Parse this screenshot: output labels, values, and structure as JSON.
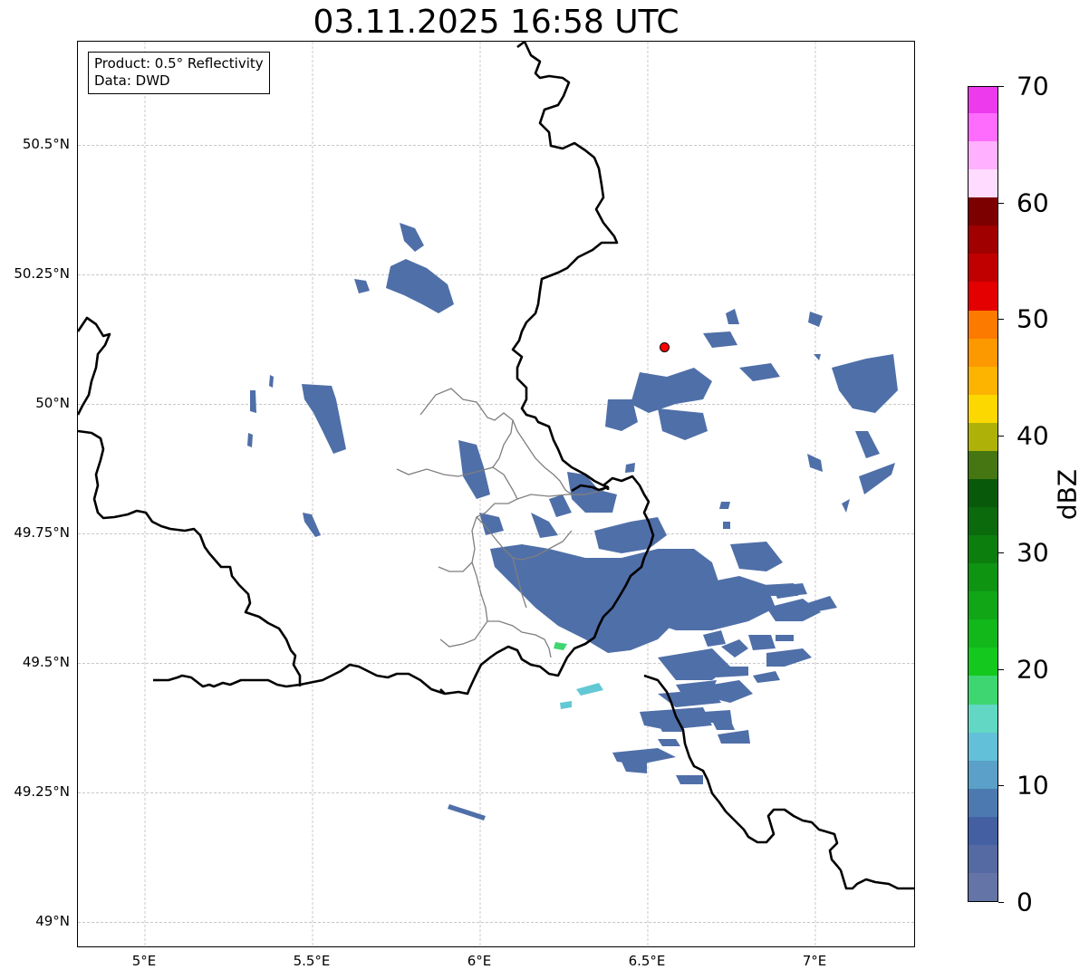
{
  "title": "03.11.2025 16:58 UTC",
  "legend": {
    "product_line": "Product: 0.5° Reflectivity",
    "data_line": "Data: DWD"
  },
  "axes": {
    "lat_labels": [
      {
        "value": 50.5,
        "text": "50.5°N"
      },
      {
        "value": 50.25,
        "text": "50.25°N"
      },
      {
        "value": 50.0,
        "text": "50°N"
      },
      {
        "value": 49.75,
        "text": "49.75°N"
      },
      {
        "value": 49.5,
        "text": "49.5°N"
      },
      {
        "value": 49.25,
        "text": "49.25°N"
      },
      {
        "value": 49.0,
        "text": "49°N"
      }
    ],
    "lon_labels": [
      {
        "value": 5.0,
        "text": "5°E"
      },
      {
        "value": 5.5,
        "text": "5.5°E"
      },
      {
        "value": 6.0,
        "text": "6°E"
      },
      {
        "value": 6.5,
        "text": "6.5°E"
      },
      {
        "value": 7.0,
        "text": "7°E"
      }
    ],
    "lon_range": [
      4.8,
      7.3
    ],
    "lat_range": [
      48.95,
      50.7
    ],
    "grid": true
  },
  "colorbar": {
    "unit": "dBZ",
    "range": [
      0,
      70
    ],
    "ticks": [
      0,
      10,
      20,
      30,
      40,
      50,
      60,
      70
    ],
    "colors": [
      "#6474a6",
      "#556aa3",
      "#4460a3",
      "#4c7ab0",
      "#5aa0c8",
      "#62c0d8",
      "#62d8c4",
      "#3ed670",
      "#14c81e",
      "#12b81a",
      "#10a616",
      "#0f9412",
      "#0c7e0e",
      "#0a6a0c",
      "#085a0a",
      "#467612",
      "#aeb208",
      "#fcd800",
      "#fcb400",
      "#fc9800",
      "#fc7a00",
      "#e40000",
      "#c00000",
      "#a00000",
      "#7c0000",
      "#ffdcff",
      "#ffb0ff",
      "#fe6cfe",
      "#ec3aec"
    ]
  },
  "radar_site": {
    "lon": 6.55,
    "lat": 50.11,
    "color": "#ff0000"
  }
}
